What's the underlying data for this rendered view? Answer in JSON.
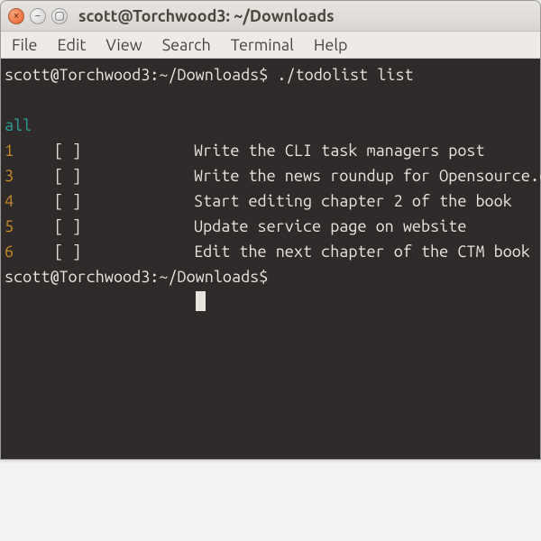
{
  "window": {
    "title": "scott@Torchwood3: ~/Downloads"
  },
  "menubar": {
    "file": "File",
    "edit": "Edit",
    "view": "View",
    "search": "Search",
    "terminal": "Terminal",
    "help": "Help"
  },
  "colors": {
    "bg": "#2f2b2a",
    "fg": "#e8e3dc",
    "cyan": "#2aa198",
    "orange": "#cb8a2b"
  },
  "shell": {
    "prompt": "scott@Torchwood3:~/Downloads$",
    "command": "./todolist list"
  },
  "list": {
    "heading": "all",
    "checkbox": "[ ]",
    "items": [
      {
        "id": "1",
        "text": "Write the CLI task managers post"
      },
      {
        "id": "3",
        "text": "Write the news roundup for Opensource.com"
      },
      {
        "id": "4",
        "text": "Start editing chapter 2 of the book"
      },
      {
        "id": "5",
        "text": "Update service page on website"
      },
      {
        "id": "6",
        "text": "Edit the next chapter of the CTM book"
      }
    ]
  }
}
